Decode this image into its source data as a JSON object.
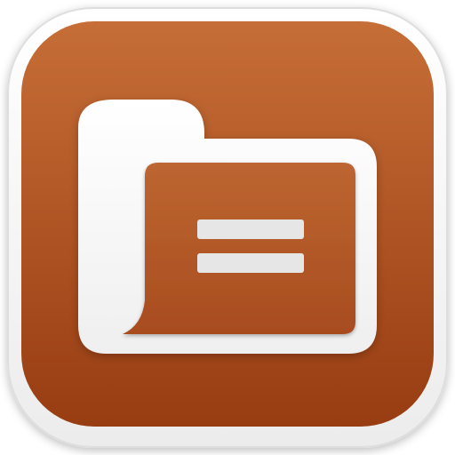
{
  "icon": {
    "name": "folder-document-app-icon",
    "glyph": "folder-icon",
    "detail": "equals-lines-icon",
    "colors": {
      "frame_outer": "#f4f4f4",
      "frame_inner": "#e2e2e2",
      "tile_top": "#c66e37",
      "tile_bottom": "#983c12",
      "folder": "#f5f5f5",
      "folder_inner_top": "#bd6631",
      "folder_inner_bottom": "#a84c1f",
      "lines": "#e6e6e6"
    }
  }
}
